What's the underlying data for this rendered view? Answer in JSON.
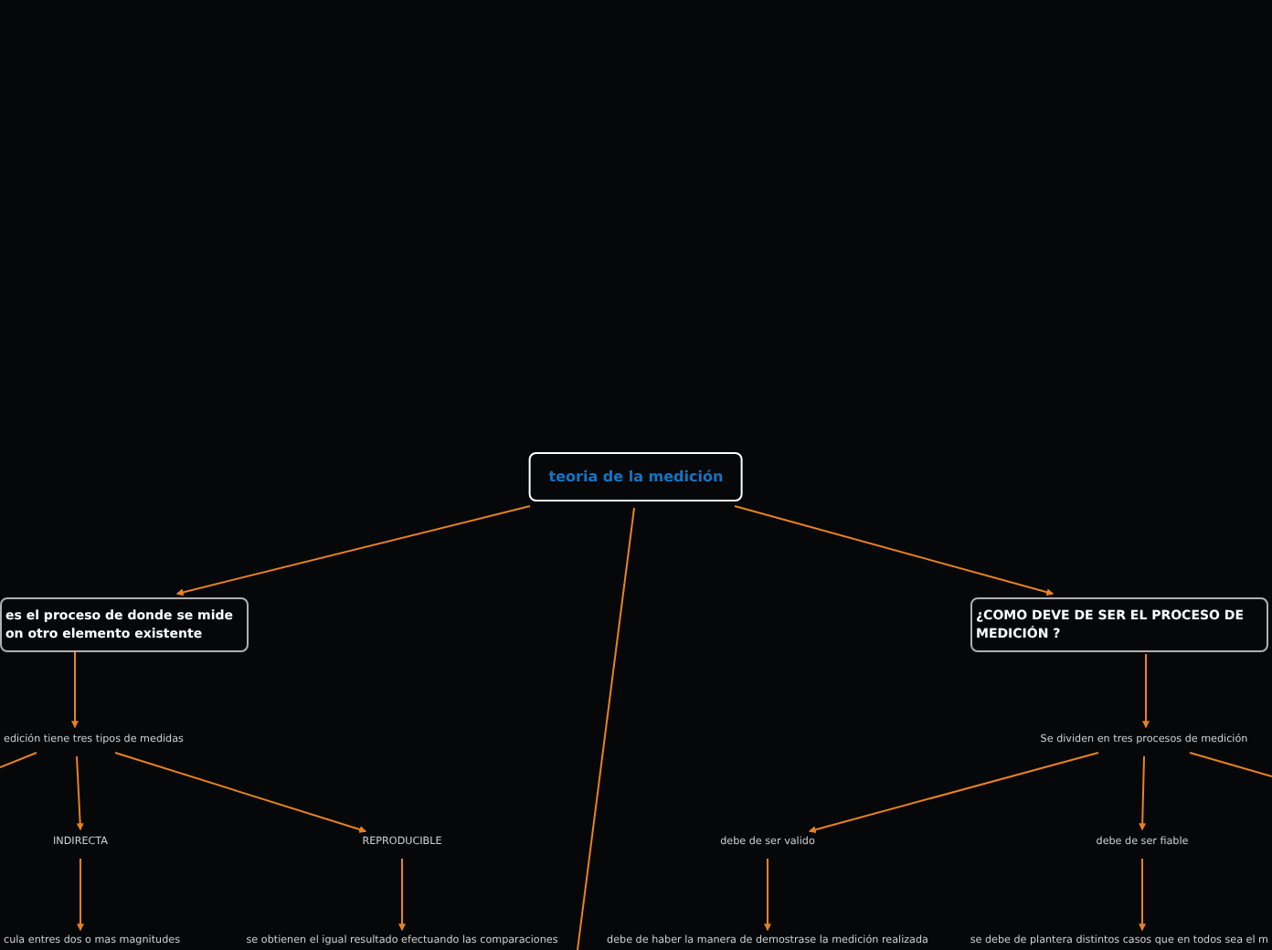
{
  "root": {
    "kind": "root",
    "text": "teoria de la medición",
    "children": [
      {
        "kind": "topic",
        "text": "es el proceso de donde se mide on otro elemento existente",
        "children": [
          {
            "kind": "label",
            "text": "edición tiene tres tipos de medidas",
            "children": [
              {
                "kind": "label",
                "text": "INDIRECTA",
                "children": [
                  {
                    "kind": "label",
                    "text": "cula entres dos o mas magnitudes"
                  }
                ]
              },
              {
                "kind": "label",
                "text": "REPRODUCIBLE",
                "children": [
                  {
                    "kind": "label",
                    "text": "se obtienen el igual resultado efectuando las comparaciones"
                  }
                ]
              }
            ]
          }
        ]
      },
      {
        "kind": "topic",
        "text": "¿COMO DEVE DE SER EL PROCESO DE MEDICIÓN ?",
        "children": [
          {
            "kind": "label",
            "text": "Se dividen en tres procesos de medición",
            "children": [
              {
                "kind": "label",
                "text": "debe de ser valido",
                "children": [
                  {
                    "kind": "label",
                    "text": "debe de haber la manera de demostrase la medición realizada"
                  }
                ]
              },
              {
                "kind": "label",
                "text": "debe de ser fiable",
                "children": [
                  {
                    "kind": "label",
                    "text": "se debe de plantera distintos casos que en todos sea el m"
                  }
                ]
              }
            ]
          }
        ]
      }
    ]
  }
}
